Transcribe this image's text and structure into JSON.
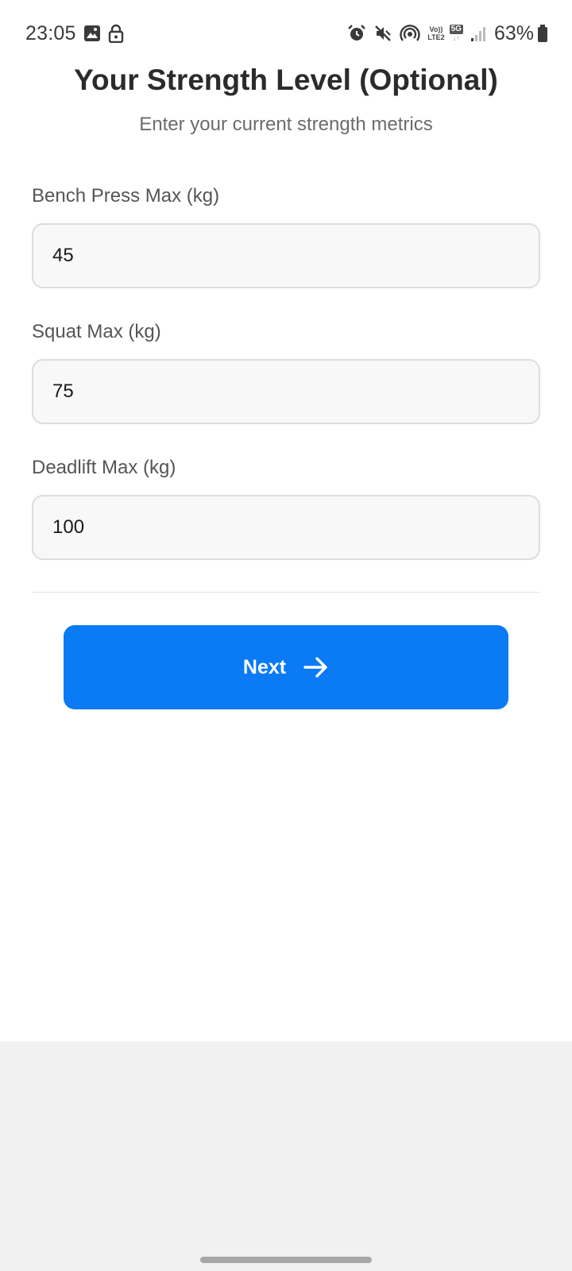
{
  "status_bar": {
    "time": "23:05",
    "left_icons": [
      "gallery-icon",
      "lock-icon"
    ],
    "right_icons": [
      "alarm-icon",
      "mute-icon",
      "hotspot-icon",
      "volte-icon",
      "5g-icon",
      "signal-icon",
      "battery-icon"
    ],
    "volte_line1": "Vo))",
    "volte_line2": "LTE2",
    "network_type": "5G",
    "battery_percent": "63%"
  },
  "header": {
    "title": "Your Strength Level (Optional)",
    "subtitle": "Enter your current strength metrics"
  },
  "form": {
    "fields": [
      {
        "label": "Bench Press Max (kg)",
        "value": "45"
      },
      {
        "label": "Squat Max (kg)",
        "value": "75"
      },
      {
        "label": "Deadlift Max (kg)",
        "value": "100"
      }
    ]
  },
  "next_button": {
    "label": "Next",
    "icon": "arrow-right-icon",
    "color": "#0a7af5"
  }
}
